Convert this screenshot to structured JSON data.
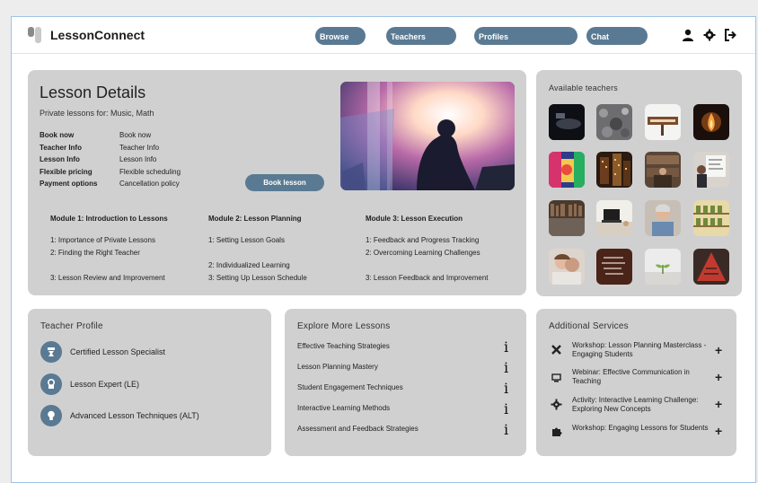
{
  "app": {
    "brand": "LessonConnect"
  },
  "nav": {
    "browse": "Browse",
    "teachers": "Teachers",
    "profiles": "Profiles",
    "chat": "Chat"
  },
  "icons": {
    "profile": "user-icon",
    "settings": "gear-icon",
    "logout": "logout-icon"
  },
  "lesson": {
    "title": "Lesson Details",
    "subtitle": "Private lessons for: Music, Math",
    "details": [
      {
        "key": "Book now",
        "value": "Book now"
      },
      {
        "key": "Teacher Info",
        "value": "Teacher Info"
      },
      {
        "key": "Lesson Info",
        "value": "Lesson Info"
      },
      {
        "key": "Flexible pricing",
        "value": "Flexible scheduling"
      },
      {
        "key": "Payment options",
        "value": "Cancellation policy"
      }
    ],
    "book_button": "Book lesson",
    "modules": [
      {
        "title": "Module 1: Introduction to Lessons",
        "items": [
          "1: Importance of Private Lessons",
          "2: Finding the Right Teacher",
          "3: Lesson Review and Improvement"
        ]
      },
      {
        "title": "Module 2: Lesson Planning",
        "items": [
          "1: Setting Lesson Goals",
          "2: Individualized Learning",
          "3: Setting Up Lesson Schedule"
        ]
      },
      {
        "title": "Module 3: Lesson Execution",
        "items": [
          "1: Feedback and Progress Tracking",
          "2: Overcoming Learning Challenges",
          "3: Lesson Feedback and Improvement"
        ]
      }
    ]
  },
  "teachers": {
    "title": "Available teachers",
    "thumbs": [
      "dark-desk-photo",
      "pebbles-photo",
      "sign-board-photo",
      "candle-photo",
      "graffiti-photo",
      "city-night-photo",
      "library-photo",
      "whiteboard-photo",
      "bookshelf-photo",
      "laptop-desk-photo",
      "elder-woman-photo",
      "shelf-jars-photo",
      "hug-photo",
      "chalk-text-photo",
      "sprout-photo",
      "red-sign-photo"
    ]
  },
  "profile": {
    "title": "Teacher Profile",
    "items": [
      {
        "label": "Certified Lesson Specialist",
        "icon": "certificate-icon"
      },
      {
        "label": "Lesson Expert (LE)",
        "icon": "award-icon"
      },
      {
        "label": "Advanced Lesson Techniques (ALT)",
        "icon": "lightbulb-icon"
      }
    ]
  },
  "explore": {
    "title": "Explore More Lessons",
    "items": [
      "Effective Teaching Strategies",
      "Lesson Planning Mastery",
      "Student Engagement Techniques",
      "Interactive Learning Methods",
      "Assessment and Feedback Strategies"
    ]
  },
  "services": {
    "title": "Additional Services",
    "items": [
      {
        "label": "Workshop: Lesson Planning Masterclass - Engaging Students",
        "icon": "tools-icon"
      },
      {
        "label": "Webinar: Effective Communication in Teaching",
        "icon": "screen-icon"
      },
      {
        "label": "Activity: Interactive Learning Challenge: Exploring New Concepts",
        "icon": "gear-icon"
      },
      {
        "label": "Workshop: Engaging Lessons for Students",
        "icon": "puzzle-icon"
      }
    ]
  },
  "colors": {
    "accent": "#5a7a93",
    "card": "#d0d0d0"
  }
}
